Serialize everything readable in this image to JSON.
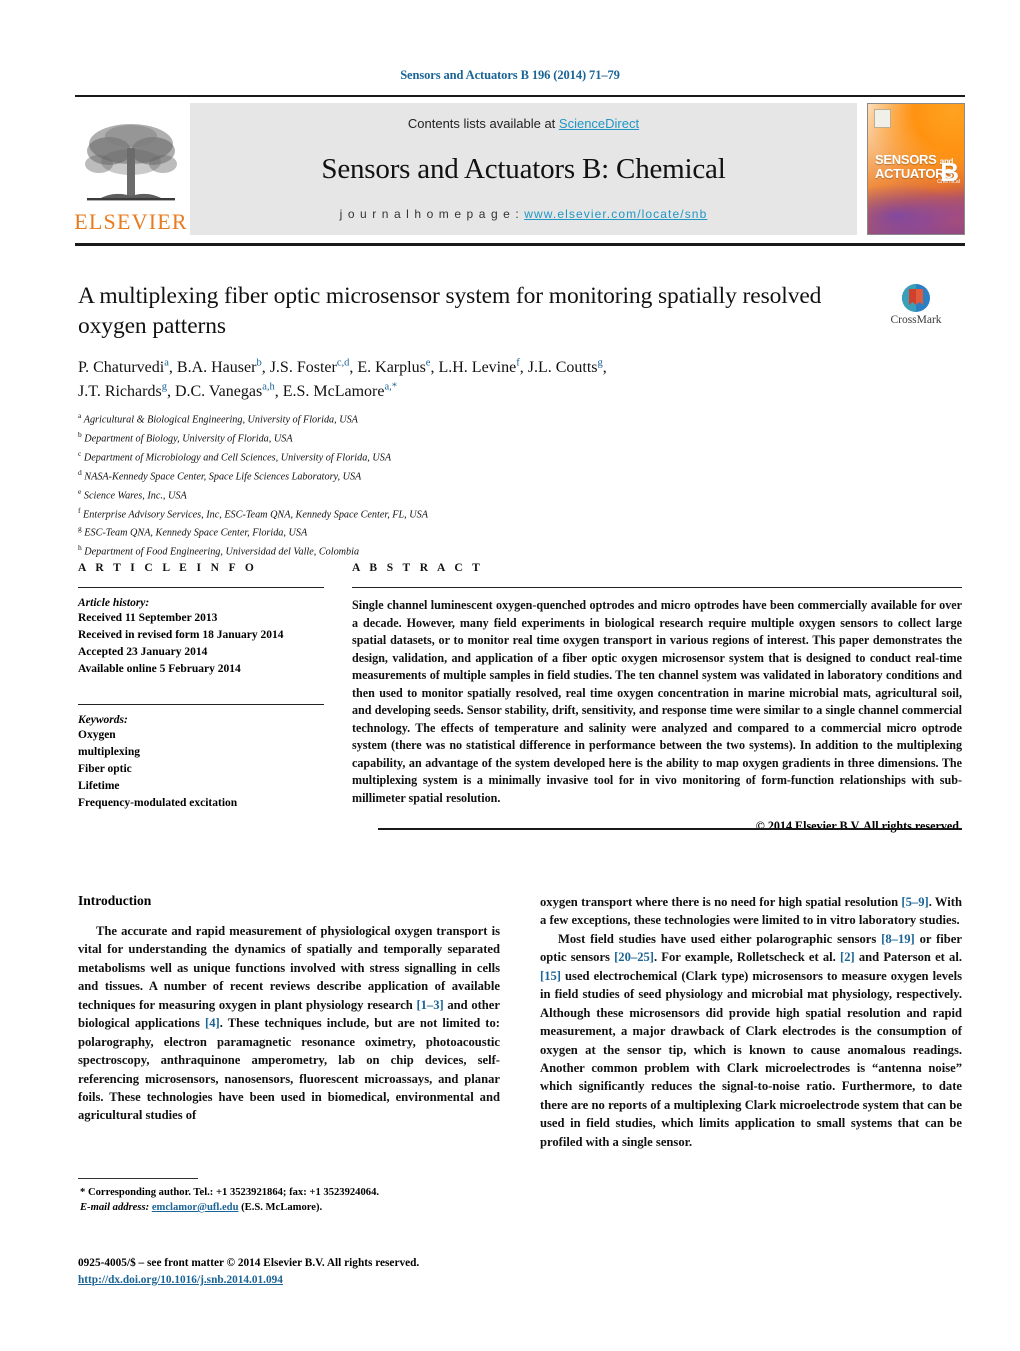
{
  "running_head": "Sensors and Actuators B 196 (2014) 71–79",
  "masthead": {
    "contents_prefix": "Contents lists available at ",
    "sciencedirect": "ScienceDirect",
    "journal_title": "Sensors and Actuators B: Chemical",
    "homepage_label": "j o u r n a l   h o m e p a g e :  ",
    "homepage_url": "www.elsevier.com/locate/snb",
    "publisher": "ELSEVIER",
    "cover": {
      "line1": "SENSORS",
      "and": "and",
      "line2": "ACTUATORS",
      "volume_letter": "B",
      "sub": "Chemical"
    },
    "accent_orange": "#E87B1E",
    "accent_link": "#2196c4",
    "panel_gray": "#e6e6e6"
  },
  "article": {
    "title": "A multiplexing fiber optic microsensor system for monitoring spatially resolved oxygen patterns",
    "authors_line1": "P. Chaturvedi a, B.A. Hauser b, J.S. Foster c,d, E. Karplus e, L.H. Levine f, J.L. Coutts g,",
    "authors_line2": "J.T. Richards g, D.C. Vanegas a,h, E.S. McLamore a,*",
    "authors": [
      {
        "name": "P. Chaturvedi",
        "marks": "a",
        "sep": ", "
      },
      {
        "name": "B.A. Hauser",
        "marks": "b",
        "sep": ", "
      },
      {
        "name": "J.S. Foster",
        "marks": "c,d",
        "sep": ", "
      },
      {
        "name": "E. Karplus",
        "marks": "e",
        "sep": ", "
      },
      {
        "name": "L.H. Levine",
        "marks": "f",
        "sep": ", "
      },
      {
        "name": "J.L. Coutts",
        "marks": "g",
        "sep": ","
      },
      {
        "name": "J.T. Richards",
        "marks": "g",
        "sep": ", "
      },
      {
        "name": "D.C. Vanegas",
        "marks": "a,h",
        "sep": ", "
      },
      {
        "name": "E.S. McLamore",
        "marks": "a,*",
        "sep": ""
      }
    ],
    "crossmark_label": "CrossMark"
  },
  "affiliations": [
    {
      "mark": "a",
      "text": "Agricultural & Biological Engineering, University of Florida, USA"
    },
    {
      "mark": "b",
      "text": "Department of Biology, University of Florida, USA"
    },
    {
      "mark": "c",
      "text": "Department of Microbiology and Cell Sciences, University of Florida, USA"
    },
    {
      "mark": "d",
      "text": "NASA-Kennedy Space Center, Space Life Sciences Laboratory, USA"
    },
    {
      "mark": "e",
      "text": "Science Wares, Inc., USA"
    },
    {
      "mark": "f",
      "text": "Enterprise Advisory Services, Inc, ESC-Team QNA, Kennedy Space Center, FL, USA"
    },
    {
      "mark": "g",
      "text": "ESC-Team QNA, Kennedy Space Center, Florida, USA"
    },
    {
      "mark": "h",
      "text": "Department of Food Engineering, Universidad del Valle, Colombia"
    }
  ],
  "article_info": {
    "heading": "A R T I C L E   I N F O",
    "history_label": "Article history:",
    "history": [
      "Received 11 September 2013",
      "Received in revised form 18 January 2014",
      "Accepted 23 January 2014",
      "Available online 5 February 2014"
    ],
    "keywords_label": "Keywords:",
    "keywords": [
      "Oxygen",
      "multiplexing",
      "Fiber optic",
      "Lifetime",
      "Frequency-modulated excitation"
    ]
  },
  "abstract": {
    "heading": "A B S T R A C T",
    "body": "Single channel luminescent oxygen-quenched optrodes and micro optrodes have been commercially available for over a decade. However, many field experiments in biological research require multiple oxygen sensors to collect large spatial datasets, or to monitor real time oxygen transport in various regions of interest. This paper demonstrates the design, validation, and application of a fiber optic oxygen microsensor system that is designed to conduct real-time measurements of multiple samples in field studies. The ten channel system was validated in laboratory conditions and then used to monitor spatially resolved, real time oxygen concentration in marine microbial mats, agricultural soil, and developing seeds. Sensor stability, drift, sensitivity, and response time were similar to a single channel commercial technology. The effects of temperature and salinity were analyzed and compared to a commercial micro optrode system (there was no statistical difference in performance between the two systems). In addition to the multiplexing capability, an advantage of the system developed here is the ability to map oxygen gradients in three dimensions. The multiplexing system is a minimally invasive tool for in vivo monitoring of form-function relationships with sub-millimeter spatial resolution.",
    "copyright": "© 2014 Elsevier B.V. All rights reserved."
  },
  "introduction": {
    "heading": "Introduction",
    "left_para": "The accurate and rapid measurement of physiological oxygen transport is vital for understanding the dynamics of spatially and temporally separated metabolisms well as unique functions involved with stress signalling in cells and tissues. A number of recent reviews describe application of available techniques for measuring oxygen in plant physiology research [1–3] and other biological applications [4]. These techniques include, but are not limited to: polarography, electron paramagnetic resonance oximetry, photoacoustic spectroscopy, anthraquinone amperometry, lab on chip devices, self-referencing microsensors, nanosensors, fluorescent microassays, and planar foils. These technologies have been used in biomedical, environmental and agricultural studies of",
    "right_para_1": "oxygen transport where there is no need for high spatial resolution [5–9]. With a few exceptions, these technologies were limited to in vitro laboratory studies.",
    "right_para_2": "Most field studies have used either polarographic sensors [8–19] or fiber optic sensors [20–25]. For example, Rolletscheck et al. [2] and Paterson et al. [15] used electrochemical (Clark type) microsensors to measure oxygen levels in field studies of seed physiology and microbial mat physiology, respectively. Although these microsensors did provide high spatial resolution and rapid measurement, a major drawback of Clark electrodes is the consumption of oxygen at the sensor tip, which is known to cause anomalous readings. Another common problem with Clark microelectrodes is \"antenna noise\" which significantly reduces the signal-to-noise ratio. Furthermore, to date there are no reports of a multiplexing Clark microelectrode system that can be used in field studies, which limits application to small systems that can be profiled with a single sensor."
  },
  "footnotes": {
    "corresponding": "* Corresponding author. Tel.: +1 3523921864; fax: +1 3523924064.",
    "email_label": "E-mail address:",
    "email": "emclamor@ufl.edu",
    "email_owner": "(E.S. McLamore).",
    "front_matter": "0925-4005/$ – see front matter © 2014 Elsevier B.V. All rights reserved.",
    "doi": "http://dx.doi.org/10.1016/j.snb.2014.01.094"
  }
}
